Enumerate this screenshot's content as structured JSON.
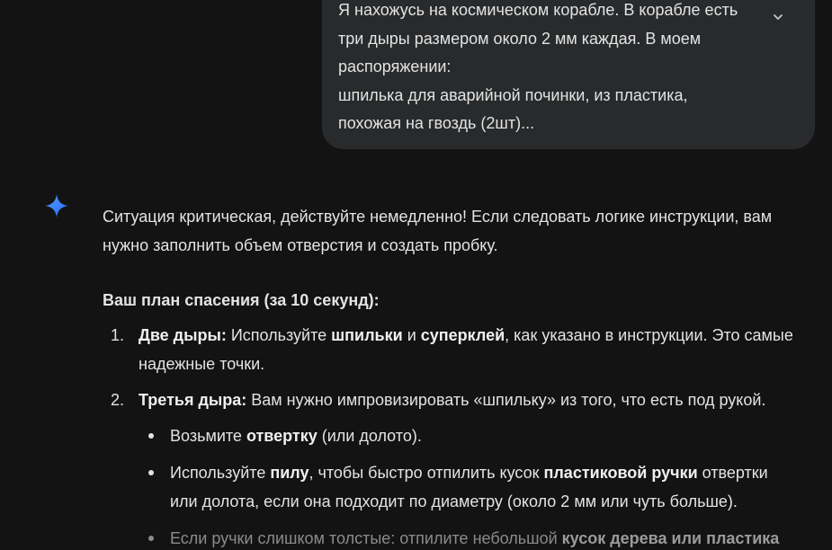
{
  "user_message": {
    "lines": [
      "Я нахожусь на космическом корабле. В корабле есть",
      "три дыры размером около 2 мм каждая. В моем",
      "распоряжении:",
      "шпилька для аварийной починки, из пластика,",
      "похожая на гвоздь (2шт)..."
    ],
    "expand_icon": "chevron-down-icon"
  },
  "assistant": {
    "avatar_icon": "gemini-spark-icon",
    "intro_lines": [
      "Ситуация критическая, действуйте немедленно! Если следовать логике инструкции, вам",
      "нужно заполнить объем отверстия и создать пробку."
    ],
    "plan_heading": "Ваш план спасения (за 10 секунд):",
    "steps": [
      {
        "number": "1.",
        "title": "Две дыры:",
        "t1": " Используйте ",
        "b1": "шпильки",
        "t2": " и ",
        "b2": "суперклей",
        "t3": ", как указано в инструкции. Это самые",
        "line2": "надежные точки."
      },
      {
        "number": "2.",
        "title": "Третья дыра:",
        "text": " Вам нужно импровизировать «шпильку» из того, что есть под рукой."
      }
    ],
    "bullets": [
      {
        "t1": "Возьмите ",
        "b1": "отвертку",
        "t2": " (или долото)."
      },
      {
        "t1": "Используйте ",
        "b1": "пилу",
        "t2": ", чтобы быстро отпилить кусок ",
        "b2": "пластиковой ручки",
        "t3": " отвертки",
        "line2": "или долота, если она подходит по диаметру (около 2 мм или чуть больше)."
      },
      {
        "t1": "Если ручки слишком толстые: отпилите небольшой ",
        "b1": "кусок дерева или пластика"
      }
    ]
  },
  "colors": {
    "background": "#131314",
    "bubble": "#282a2c",
    "text": "#e3e3e3",
    "spark_start": "#4e8df5",
    "spark_end": "#1f6bff"
  }
}
